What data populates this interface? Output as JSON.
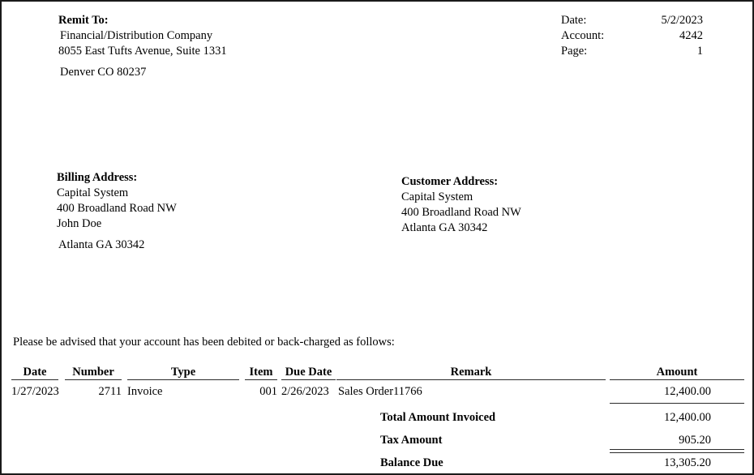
{
  "document": {
    "type": "invoice-debit-memo"
  },
  "header_meta": {
    "rows": [
      {
        "label": "Date:",
        "value": "5/2/2023"
      },
      {
        "label": "Account:",
        "value": "4242"
      },
      {
        "label": "Page:",
        "value": "1"
      }
    ]
  },
  "remit_to": {
    "heading": "Remit To:",
    "lines": [
      "Financial/Distribution Company",
      "8055 East Tufts Avenue, Suite 1331",
      "Denver CO 80237"
    ]
  },
  "billing_address": {
    "heading": "Billing Address:",
    "lines": [
      "Capital System",
      "400 Broadland Road NW",
      "John Doe",
      "Atlanta GA 30342"
    ]
  },
  "customer_address": {
    "heading": "Customer Address:",
    "lines": [
      "Capital System",
      "400 Broadland Road NW",
      "Atlanta GA 30342"
    ]
  },
  "advisory": {
    "text": "Please be advised that your account has been debited or back-charged as follows:"
  },
  "table": {
    "columns": [
      {
        "key": "date",
        "label": "Date"
      },
      {
        "key": "number",
        "label": "Number"
      },
      {
        "key": "type",
        "label": "Type"
      },
      {
        "key": "item",
        "label": "Item"
      },
      {
        "key": "due_date",
        "label": "Due Date"
      },
      {
        "key": "remark",
        "label": "Remark"
      },
      {
        "key": "amount",
        "label": "Amount"
      }
    ],
    "rows": [
      {
        "date": "1/27/2023",
        "number": "2711",
        "type": "Invoice",
        "item": "001",
        "due_date": "2/26/2023",
        "remark": "Sales Order11766",
        "amount": "12,400.00"
      }
    ]
  },
  "totals": [
    {
      "label": "Total Amount Invoiced",
      "value": "12,400.00"
    },
    {
      "label": "Tax Amount",
      "value": "905.20"
    },
    {
      "label": "Balance Due",
      "value": "13,305.20"
    }
  ],
  "colors": {
    "page_border": "#1a1a1a",
    "rule": "#2b2b2b",
    "text": "#000000",
    "background": "#ffffff"
  }
}
